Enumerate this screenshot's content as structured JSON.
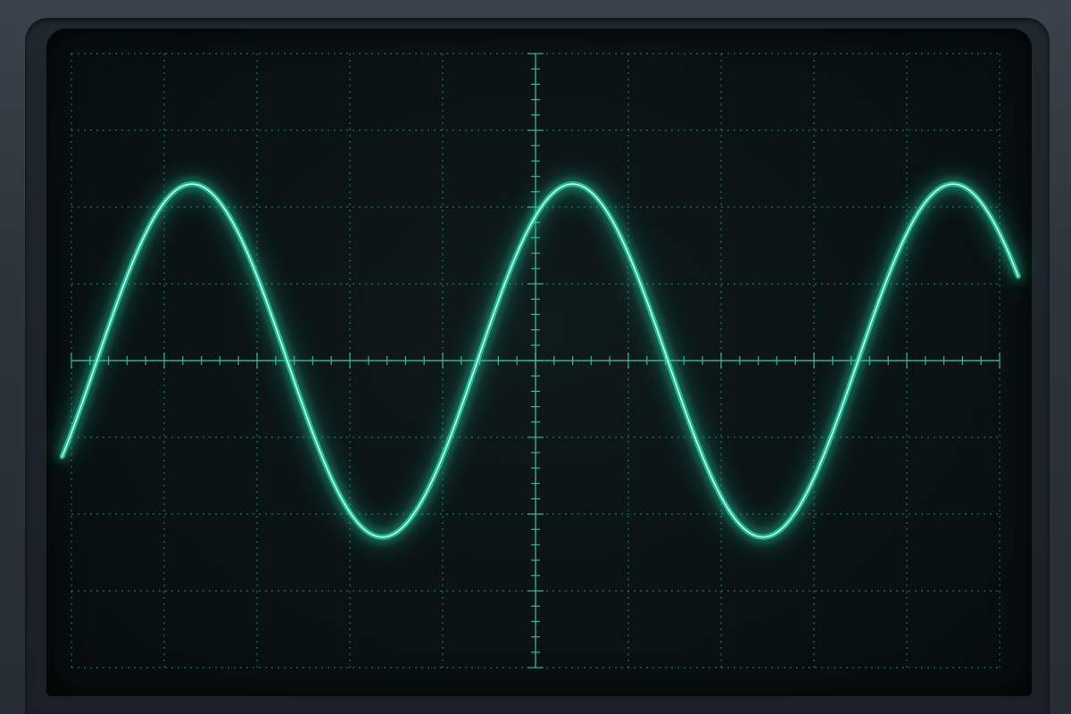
{
  "chart_data": {
    "type": "line",
    "title": "",
    "xlabel": "",
    "ylabel": "",
    "grid": true,
    "x_divisions": 10,
    "y_divisions": 8,
    "xlim": [
      0,
      10
    ],
    "ylim": [
      -4,
      4
    ],
    "series": [
      {
        "waveform": "sine",
        "amplitude_div": 2.3,
        "period_div": 4.1,
        "peak_at_div": 1.3,
        "x_start_div": -0.1,
        "x_end_div": 10.2
      }
    ]
  },
  "colors": {
    "trace": "#6ff5d2",
    "trace_glow": "#28d9ad",
    "grid": "#2f8f77",
    "axis": "#3fb898"
  }
}
